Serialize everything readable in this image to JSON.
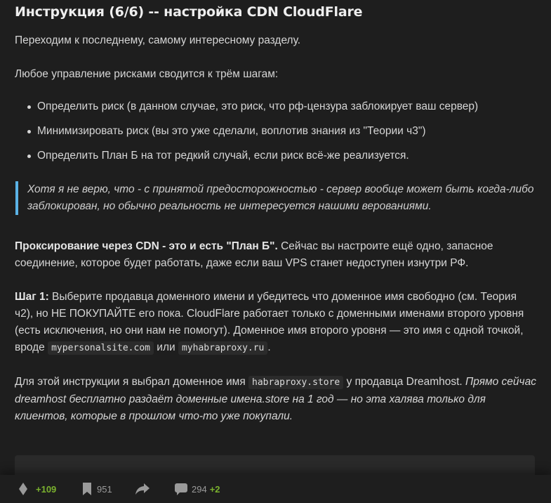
{
  "article": {
    "title": "Инструкция (6/6) -- настройка CDN CloudFlare",
    "intro": "Переходим к последнему, самому интересному разделу.",
    "steps_intro": "Любое управление рисками сводится к трём шагам:",
    "risk_steps": [
      "Определить риск (в данном случае, это риск, что рф-цензура заблокирует ваш сервер)",
      "Минимизировать риск (вы это уже сделали, воплотив знания из \"Теории ч3\")",
      "Определить План Б на тот редкий случай, если риск всё-же реализуется."
    ],
    "quote": "Хотя я не верю, что - с принятой предосторожностью - сервер вообще может быть когда-либо заблокирован, но обычно реальность не интересуется нашими верованиями.",
    "proxy_bold": "Проксирование через CDN - это и есть \"План Б\".",
    "proxy_text": " Сейчас вы настроите ещё одно, запасное соединение, которое будет работать, даже если ваш VPS станет недоступен изнутри РФ.",
    "step1_bold": "Шаг 1:",
    "step1_text": " Выберите продавца доменного имени и убедитесь что доменное имя свободно (см. Теория ч2), но НЕ ПОКУПАЙТЕ его пока. CloudFlare работает только с доменными именами второго уровня (есть исключения, но они нам не помогут). Доменное имя второго уровня — это имя с одной точкой, вроде ",
    "example_domain_1": "mypersonalsite.com",
    "or_word": " или ",
    "example_domain_2": "myhabraproxy.ru",
    "step1_end": ".",
    "choice_text_1": "Для этой инструкции я выбрал доменное имя ",
    "chosen_domain": "habraproxy.store",
    "choice_text_2": " у продавца Dreamhost. ",
    "choice_italic": "Прямо сейчас dreamhost бесплатно раздаёт доменные имена.store на 1 год — но эта халява только для клиентов, которые в прошлом что-то уже покупали."
  },
  "footer": {
    "rating": "+109",
    "bookmarks": "951",
    "comments": "294",
    "new_comments": "+2",
    "icons": {
      "rating": "rating-diamond-icon",
      "bookmarks": "bookmark-icon",
      "share": "share-arrow-icon",
      "comments": "comment-bubble-icon"
    }
  },
  "colors": {
    "background": "#1e1e1e",
    "text": "#d6d6d6",
    "quote_border": "#5bb3e6",
    "positive": "#7bb22e",
    "code_bg": "#2b2b2b"
  }
}
